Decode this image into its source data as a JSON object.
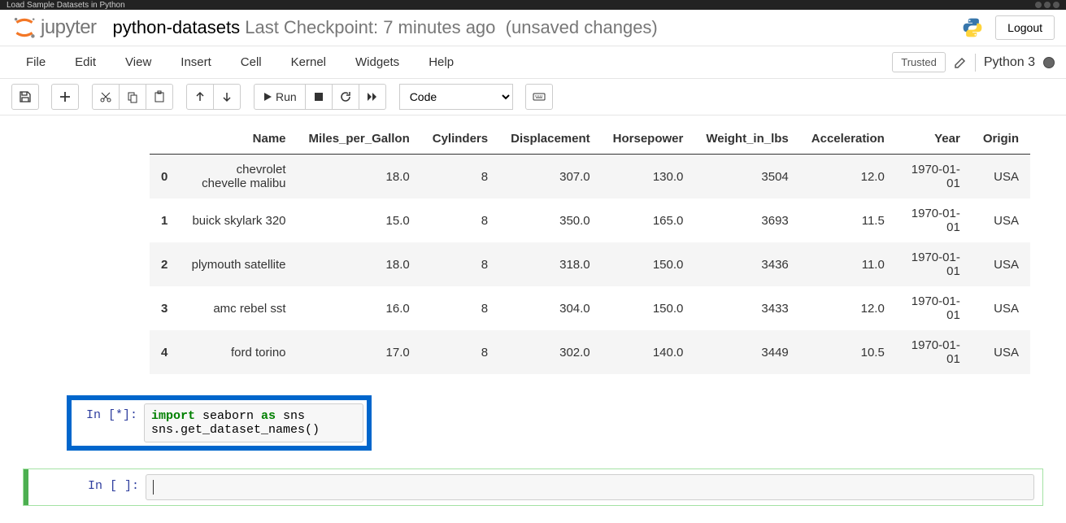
{
  "browser": {
    "tab_title": "Load Sample Datasets in Python"
  },
  "header": {
    "logo_text": "jupyter",
    "notebook_name": "python-datasets",
    "checkpoint": "Last Checkpoint: 7 minutes ago",
    "unsaved": "(unsaved changes)",
    "logout": "Logout"
  },
  "menubar": {
    "items": [
      "File",
      "Edit",
      "View",
      "Insert",
      "Cell",
      "Kernel",
      "Widgets",
      "Help"
    ],
    "trusted": "Trusted",
    "kernel": "Python 3"
  },
  "toolbar": {
    "run_label": "Run",
    "cell_type": "Code"
  },
  "table": {
    "columns": [
      "Name",
      "Miles_per_Gallon",
      "Cylinders",
      "Displacement",
      "Horsepower",
      "Weight_in_lbs",
      "Acceleration",
      "Year",
      "Origin"
    ],
    "rows": [
      {
        "idx": "0",
        "Name": "chevrolet chevelle malibu",
        "Miles_per_Gallon": "18.0",
        "Cylinders": "8",
        "Displacement": "307.0",
        "Horsepower": "130.0",
        "Weight_in_lbs": "3504",
        "Acceleration": "12.0",
        "Year": "1970-01-01",
        "Origin": "USA"
      },
      {
        "idx": "1",
        "Name": "buick skylark 320",
        "Miles_per_Gallon": "15.0",
        "Cylinders": "8",
        "Displacement": "350.0",
        "Horsepower": "165.0",
        "Weight_in_lbs": "3693",
        "Acceleration": "11.5",
        "Year": "1970-01-01",
        "Origin": "USA"
      },
      {
        "idx": "2",
        "Name": "plymouth satellite",
        "Miles_per_Gallon": "18.0",
        "Cylinders": "8",
        "Displacement": "318.0",
        "Horsepower": "150.0",
        "Weight_in_lbs": "3436",
        "Acceleration": "11.0",
        "Year": "1970-01-01",
        "Origin": "USA"
      },
      {
        "idx": "3",
        "Name": "amc rebel sst",
        "Miles_per_Gallon": "16.0",
        "Cylinders": "8",
        "Displacement": "304.0",
        "Horsepower": "150.0",
        "Weight_in_lbs": "3433",
        "Acceleration": "12.0",
        "Year": "1970-01-01",
        "Origin": "USA"
      },
      {
        "idx": "4",
        "Name": "ford torino",
        "Miles_per_Gallon": "17.0",
        "Cylinders": "8",
        "Displacement": "302.0",
        "Horsepower": "140.0",
        "Weight_in_lbs": "3449",
        "Acceleration": "10.5",
        "Year": "1970-01-01",
        "Origin": "USA"
      }
    ]
  },
  "cells": {
    "running": {
      "prompt": "In [*]:",
      "code_tokens": [
        {
          "t": "import",
          "c": "kw"
        },
        {
          "t": " seaborn ",
          "c": "nm"
        },
        {
          "t": "as",
          "c": "kw"
        },
        {
          "t": " sns\n",
          "c": "nm"
        },
        {
          "t": "sns.get_dataset_names()",
          "c": "nm"
        }
      ]
    },
    "empty": {
      "prompt": "In [ ]:"
    }
  }
}
